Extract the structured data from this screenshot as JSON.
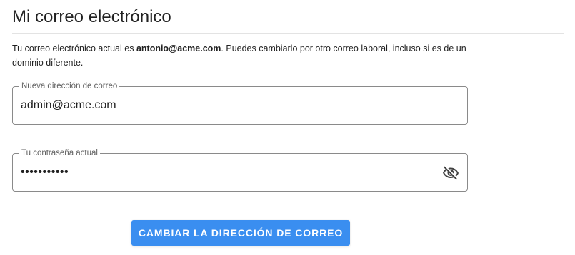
{
  "page": {
    "title": "Mi correo electrónico",
    "description": {
      "prefix": "Tu correo electrónico actual es ",
      "current_email": "antonio@acme.com",
      "suffix": ". Puedes cambiarlo por otro correo laboral, incluso si es de un dominio diferente."
    }
  },
  "form": {
    "email_field": {
      "label": "Nueva dirección de correo",
      "value": "admin@acme.com"
    },
    "password_field": {
      "label": "Tu contraseña actual",
      "value": "•••••••••••",
      "toggle_icon": "eye-off-icon"
    },
    "submit_label": "Cambiar la dirección de correo"
  },
  "colors": {
    "accent": "#3a8ef0",
    "text": "#212121",
    "border": "#8a8a8a"
  }
}
